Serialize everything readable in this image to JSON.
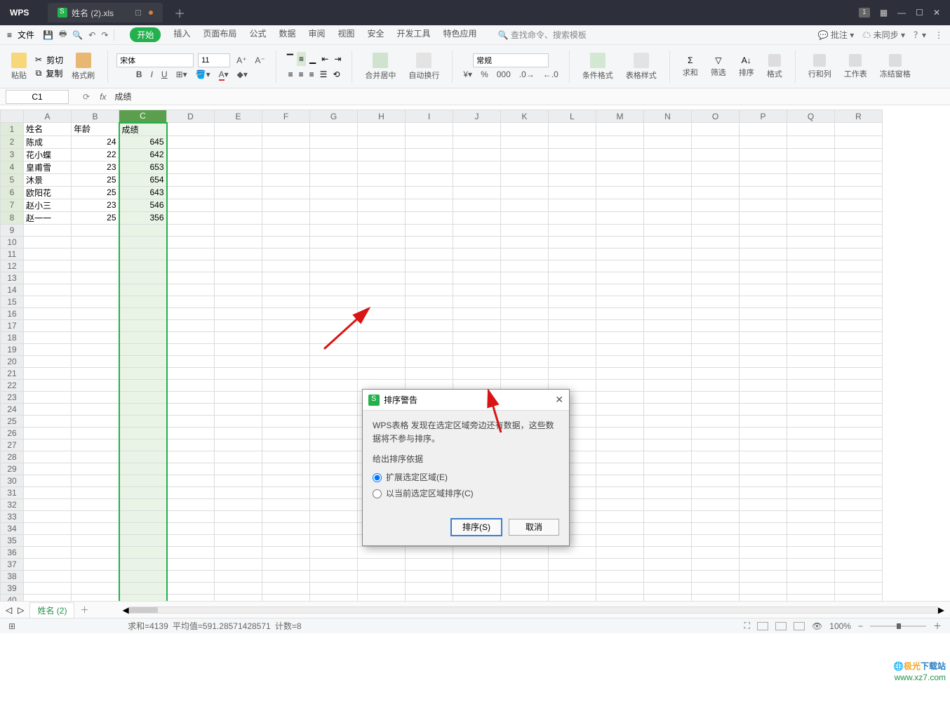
{
  "app": {
    "name": "WPS",
    "file_name": "姓名 (2).xls"
  },
  "menu": {
    "file": "文件",
    "tabs": [
      "开始",
      "插入",
      "页面布局",
      "公式",
      "数据",
      "审阅",
      "视图",
      "安全",
      "开发工具",
      "特色应用"
    ],
    "search_placeholder": "查找命令、搜索模板",
    "comments": "批注",
    "sync": "未同步"
  },
  "ribbon": {
    "paste": "粘贴",
    "cut": "剪切",
    "copy": "复制",
    "fmtpaint": "格式刷",
    "font_name": "宋体",
    "font_size": "11",
    "merge": "合并居中",
    "wrap": "自动换行",
    "number_format": "常规",
    "condfmt": "条件格式",
    "tblstyle": "表格样式",
    "sum": "求和",
    "filter": "筛选",
    "sort": "排序",
    "format": "格式",
    "rowcol": "行和列",
    "worksheet": "工作表",
    "freeze": "冻结窗格"
  },
  "namebox": "C1",
  "formula_value": "成绩",
  "columns": [
    "A",
    "B",
    "C",
    "D",
    "E",
    "F",
    "G",
    "H",
    "I",
    "J",
    "K",
    "L",
    "M",
    "N",
    "O",
    "P",
    "Q",
    "R"
  ],
  "row_header": 40,
  "data": {
    "headers": [
      "姓名",
      "年龄",
      "成绩"
    ],
    "rows": [
      {
        "name": "陈成",
        "age": 24,
        "score": 645
      },
      {
        "name": "花小蝶",
        "age": 22,
        "score": 642
      },
      {
        "name": "皇甫雪",
        "age": 23,
        "score": 653
      },
      {
        "name": "沐景",
        "age": 25,
        "score": 654
      },
      {
        "name": "欧阳花",
        "age": 25,
        "score": 643
      },
      {
        "name": "赵小三",
        "age": 23,
        "score": 546
      },
      {
        "name": "赵一一",
        "age": 25,
        "score": 356
      }
    ]
  },
  "dialog": {
    "title": "排序警告",
    "message": "WPS表格 发现在选定区域旁边还有数据，这些数据将不参与排序。",
    "legend": "给出排序依据",
    "opt1": "扩展选定区域(E)",
    "opt2": "以当前选定区域排序(C)",
    "ok": "排序(S)",
    "cancel": "取消"
  },
  "sheet_tab": "姓名 (2)",
  "statusbar": {
    "sum": "求和=4139",
    "avg": "平均值=591.28571428571",
    "count": "计数=8",
    "zoom": "100%"
  },
  "watermark": {
    "brand_a": "极光",
    "brand_b": "下载站",
    "url": "www.xz7.com"
  }
}
